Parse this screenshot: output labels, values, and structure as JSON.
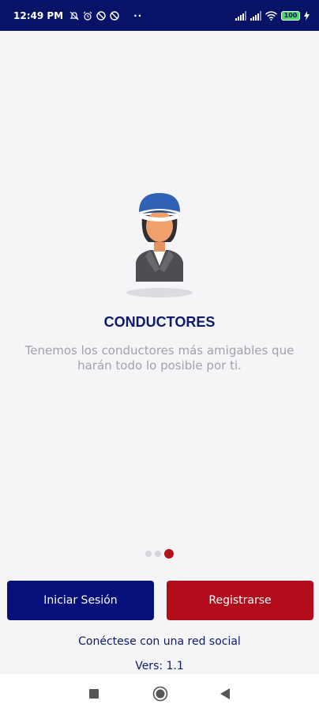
{
  "status_bar": {
    "time": "12:49 PM",
    "dots": "··",
    "battery": "100",
    "icons": [
      "mute-icon",
      "alarm-icon",
      "block-icon",
      "block-icon",
      "signal-icon",
      "signal-icon",
      "wifi-icon",
      "battery-icon",
      "charging-icon"
    ]
  },
  "onboarding": {
    "illustration": "driver-illustration",
    "title": "CONDUCTORES",
    "description": "Tenemos los conductores más amigables que harán todo lo posible por ti.",
    "page_count": 3,
    "active_page": 3
  },
  "actions": {
    "login_label": "Iniciar Sesión",
    "register_label": "Registrarse",
    "social_label": "Conéctese con una red social",
    "version_label": "Vers: 1.1"
  },
  "colors": {
    "primary": "#06107a",
    "accent": "#b30d1b",
    "status_bar": "#061367"
  },
  "nav": {
    "icons": [
      "recent-apps-icon",
      "home-icon",
      "back-icon"
    ]
  }
}
